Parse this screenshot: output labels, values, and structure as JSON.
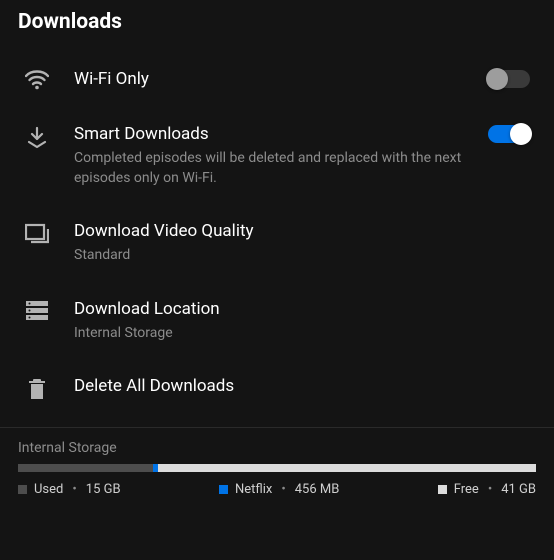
{
  "header": {
    "title": "Downloads"
  },
  "rows": {
    "wifi": {
      "title": "Wi-Fi Only",
      "enabled": false
    },
    "smart": {
      "title": "Smart Downloads",
      "sub": "Completed episodes will be deleted and replaced with the next episodes only on Wi-Fi.",
      "enabled": true
    },
    "quality": {
      "title": "Download Video Quality",
      "sub": "Standard"
    },
    "location": {
      "title": "Download Location",
      "sub": "Internal Storage"
    },
    "delete": {
      "title": "Delete All Downloads"
    }
  },
  "storage": {
    "title": "Internal Storage",
    "usedPct": 26,
    "appPct": 1,
    "freePct": 73,
    "legend": {
      "usedLabel": "Used",
      "usedValue": "15 GB",
      "appLabel": "Netflix",
      "appValue": "456 MB",
      "freeLabel": "Free",
      "freeValue": "41 GB"
    }
  }
}
